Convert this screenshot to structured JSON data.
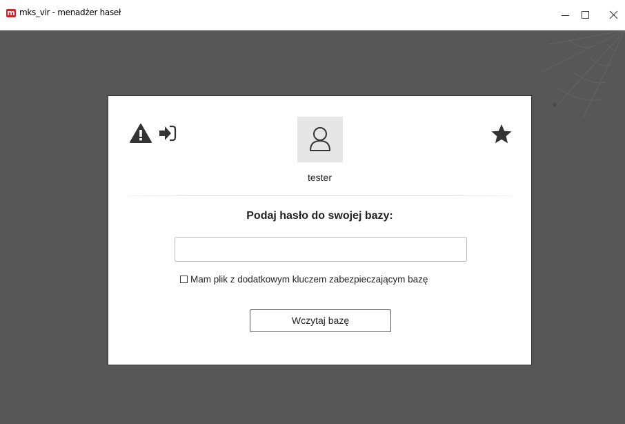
{
  "window": {
    "app_icon_letter": "m",
    "title": "mks_vir - menadżer haseł",
    "accent_color": "#e11b22"
  },
  "dialog": {
    "warning_icon": "warning-triangle-icon",
    "login_icon": "sign-in-icon",
    "favorite_icon": "star-icon",
    "avatar_icon": "user-icon",
    "username": "tester",
    "prompt": "Podaj hasło do swojej bazy:",
    "password_value": "",
    "password_placeholder": "",
    "keyfile_checked": false,
    "keyfile_label": "Mam plik z dodatkowym kluczem zabezpieczającym bazę",
    "load_button_label": "Wczytaj bazę"
  },
  "colors": {
    "background": "#575757",
    "dialog": "#ffffff"
  }
}
